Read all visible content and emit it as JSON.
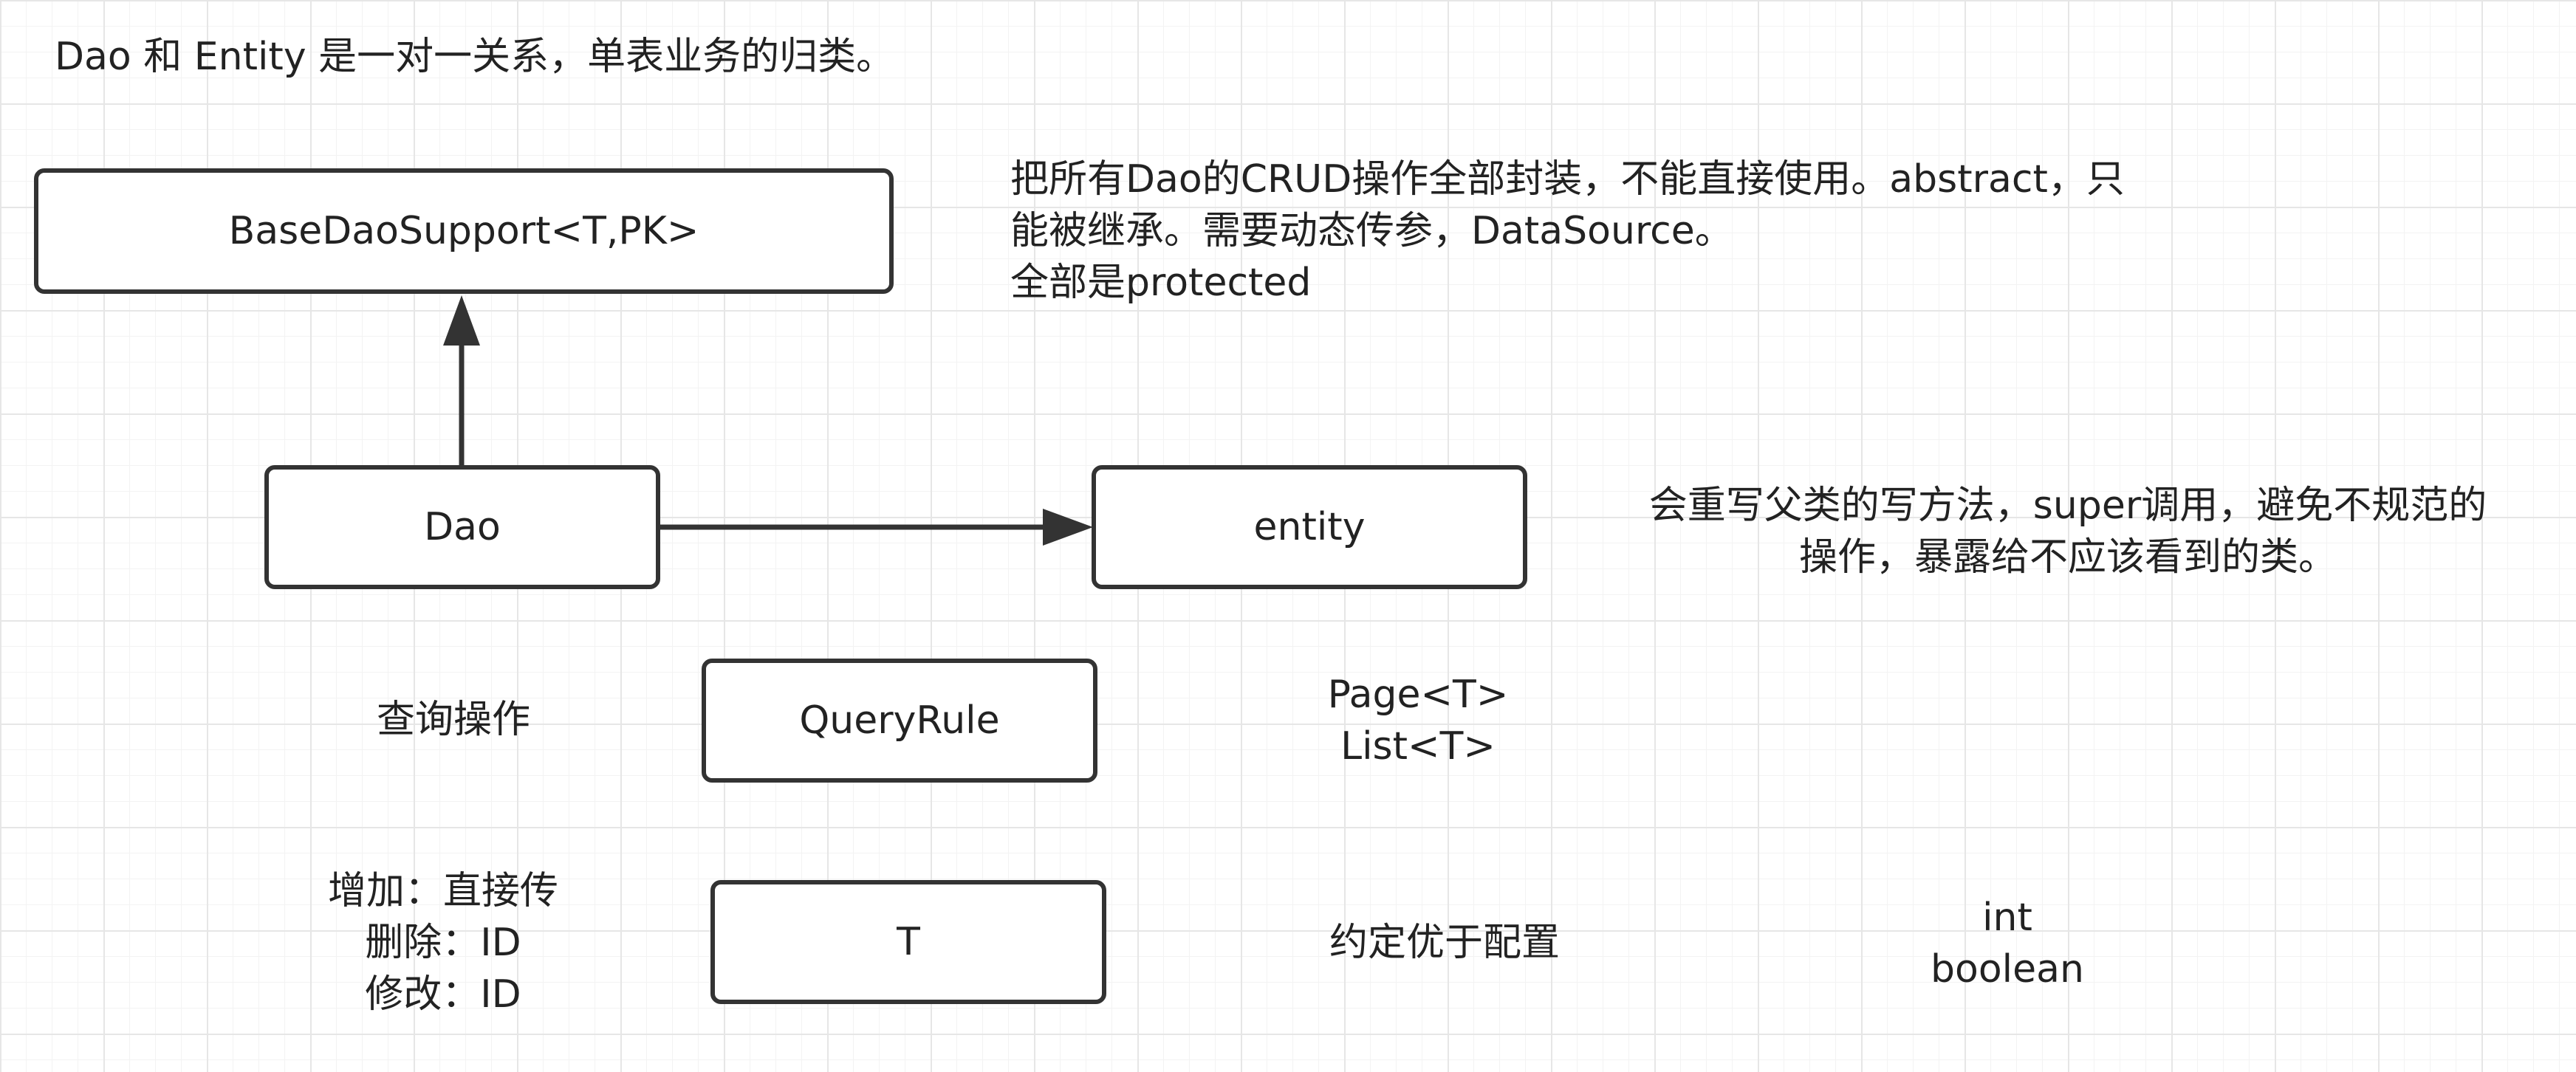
{
  "notes": {
    "title": "Dao 和 Entity 是一对一关系，单表业务的归类。",
    "base_desc": [
      "把所有Dao的CRUD操作全部封装，不能直接使用。abstract，只",
      "能被继承。需要动态传参，DataSource。",
      "全部是protected"
    ],
    "entity_desc": [
      "会重写父类的写方法，super调用，避免不规范的",
      "操作，暴露给不应该看到的类。"
    ],
    "query_label": "查询操作",
    "page_list": [
      "Page<T>",
      "List<T>"
    ],
    "crud_ops": [
      "增加：直接传",
      "删除：ID",
      "修改：ID"
    ],
    "convention": "约定优于配置",
    "return_types": [
      "int",
      "boolean"
    ]
  },
  "boxes": {
    "base": "BaseDaoSupport<T,PK>",
    "dao": "Dao",
    "entity": "entity",
    "query_rule": "QueryRule",
    "t": "T"
  },
  "colors": {
    "stroke": "#333333",
    "text": "#222222",
    "grid": "#e6e6e6"
  }
}
